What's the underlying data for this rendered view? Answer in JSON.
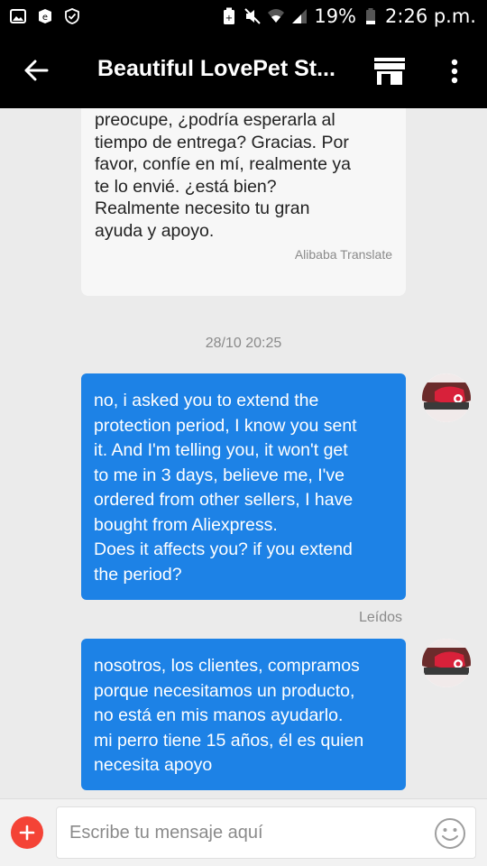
{
  "status_bar": {
    "battery": "19%",
    "time": "2:26 p.m."
  },
  "header": {
    "title": "Beautiful LovePet St..."
  },
  "messages": {
    "incoming_text": "preocupe, ¿podría esperarla al\ntiempo de entrega? Gracias. Por\nfavor, confíe en mí, realmente ya\nte lo envié. ¿está bien?\nRealmente necesito tu gran\nayuda y apoyo.",
    "incoming_translation_label": "Alibaba Translate",
    "timestamp": "28/10 20:25",
    "outgoing_1": "no, i asked you to extend the\nprotection period, I know you sent\nit. And I'm telling you, it won't get\nto me in 3 days, believe me, I've\nordered from other sellers, I have\nbought from Aliexpress.\nDoes it affects you? if you extend\nthe period?",
    "outgoing_1_status": "Leídos",
    "outgoing_2": "nosotros, los clientes, compramos\nporque necesitamos un producto,\nno está en mis manos ayudarlo.\nmi perro tiene 15 años, él es quien\nnecesita apoyo"
  },
  "input": {
    "placeholder": "Escribe tu mensaje aquí"
  },
  "colors": {
    "bubble_out": "#1d82e6",
    "add_button": "#f44336",
    "app_bar": "#000000"
  }
}
